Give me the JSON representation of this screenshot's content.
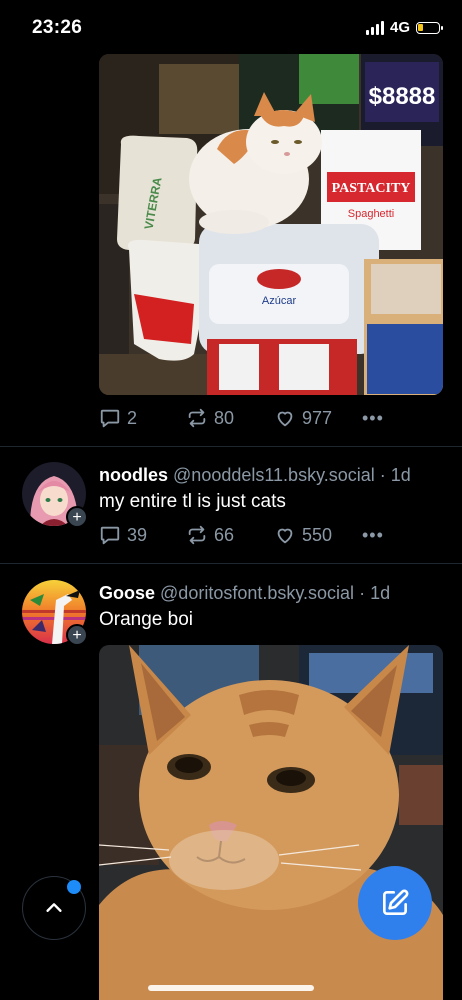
{
  "status_bar": {
    "time": "23:26",
    "network": "4G",
    "battery_level": 0.25
  },
  "posts": [
    {
      "image_text": {
        "sign": "$8888",
        "box_brand": "PASTACITY",
        "box_product": "Spaghetti",
        "bag_label": "VITERRA",
        "packet_label": "Azúcar"
      },
      "actions": {
        "replies": "2",
        "reposts": "80",
        "likes": "977",
        "more": "•••"
      }
    },
    {
      "name": "noodles",
      "handle": "@nooddels11.bsky.social",
      "time": "· 1d",
      "text": "my entire tl is just cats",
      "actions": {
        "replies": "39",
        "reposts": "66",
        "likes": "550",
        "more": "•••"
      }
    },
    {
      "name": "Goose",
      "handle": "@doritosfont.bsky.social",
      "time": "· 1d",
      "text": "Orange boi"
    }
  ],
  "colors": {
    "accent": "#2f80ed",
    "muted": "#8b98a5",
    "notification_dot": "#1d8cf8"
  },
  "icons": {
    "reply": "speech-bubble-icon",
    "repost": "repost-arrows-icon",
    "like": "heart-icon",
    "compose": "pencil-square-icon",
    "scroll_top": "chevron-up-icon"
  }
}
